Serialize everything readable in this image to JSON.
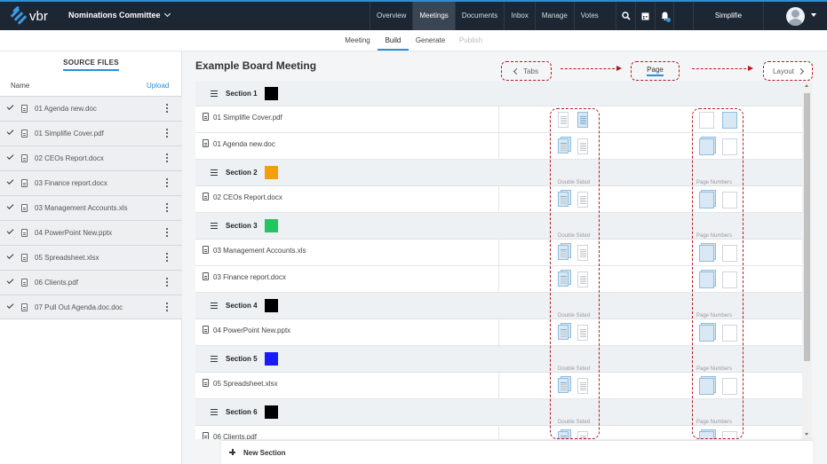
{
  "app": {
    "logo_text": "vbr",
    "committee": "Nominations Committee",
    "nav": [
      "Overview",
      "Meetings",
      "Documents",
      "Inbox",
      "Manage",
      "Votes"
    ],
    "active_nav": "Meetings",
    "user_name": "Simplifie"
  },
  "subnav": {
    "items": [
      "Meeting",
      "Build",
      "Generate",
      "Publish"
    ],
    "active": "Build",
    "disabled": "Publish"
  },
  "source_files": {
    "title": "SOURCE FILES",
    "name_header": "Name",
    "upload_label": "Upload",
    "files": [
      "01 Agenda new.doc",
      "01 Simplifie Cover.pdf",
      "02 CEOs Report.docx",
      "03 Finance report.docx",
      "03 Management Accounts.xls",
      "04 PowerPoint New.pptx",
      "05 Spreadsheet.xlsx",
      "06 Clients.pdf",
      "07 Pull Out Agenda.doc.doc"
    ]
  },
  "main": {
    "title": "Example Board Meeting",
    "tabs_label": "Tabs",
    "page_label": "Page",
    "layout_label": "Layout",
    "double_sided_label": "Double Sided",
    "page_numbers_label": "Page Numbers",
    "new_section_label": "New Section",
    "sections": [
      {
        "name": "Section 1",
        "color": "#000000",
        "docs": [
          "01 Simplifie Cover.pdf",
          "01 Agenda new.doc"
        ]
      },
      {
        "name": "Section 2",
        "color": "#f59e0b",
        "docs": [
          "02 CEOs Report.docx"
        ]
      },
      {
        "name": "Section 3",
        "color": "#22c55e",
        "docs": [
          "03 Management Accounts.xls",
          "03 Finance report.docx"
        ]
      },
      {
        "name": "Section 4",
        "color": "#000000",
        "docs": [
          "04 PowerPoint New.pptx"
        ]
      },
      {
        "name": "Section 5",
        "color": "#1a1aff",
        "docs": [
          "05 Spreadsheet.xlsx"
        ]
      },
      {
        "name": "Section 6",
        "color": "#000000",
        "docs": [
          "06 Clients.pdf"
        ]
      }
    ]
  }
}
